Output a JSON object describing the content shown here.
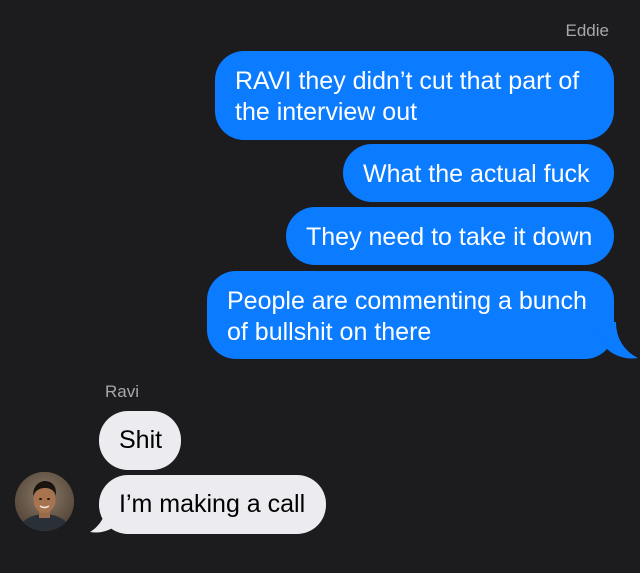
{
  "conversation": {
    "outgoing_sender": "Eddie",
    "incoming_sender": "Ravi",
    "messages": [
      {
        "from": "Eddie",
        "text": "RAVI they didn't cut that part of the interview out",
        "lines": [
          "RAVI they didn’t cut that part of",
          "the interview out"
        ]
      },
      {
        "from": "Eddie",
        "text": "What the actual fuck"
      },
      {
        "from": "Eddie",
        "text": "They need to take it down"
      },
      {
        "from": "Eddie",
        "text": "People are commenting a bunch of bullshit on there",
        "lines": [
          "People are commenting a bunch",
          "of bullshit on there"
        ]
      },
      {
        "from": "Ravi",
        "text": "Shit"
      },
      {
        "from": "Ravi",
        "text": "I’m making a call"
      }
    ]
  },
  "colors": {
    "background": "#1c1c1e",
    "outgoing_bubble": "#0b7bff",
    "incoming_bubble": "#ebebf0",
    "sender_name": "#a7a7ac"
  },
  "icons": {
    "avatar": "ravi-avatar-photo"
  }
}
